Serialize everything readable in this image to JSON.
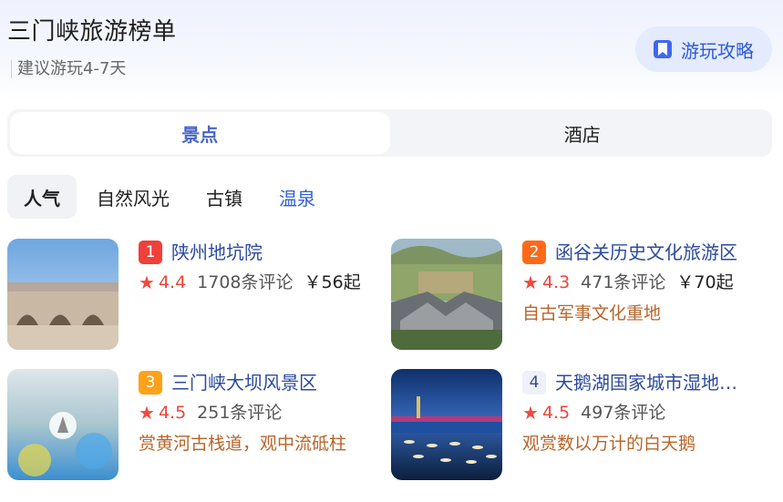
{
  "header": {
    "title": "三门峡旅游榜单",
    "subtitle": "建议游玩4-7天",
    "guide_button": "游玩攻略"
  },
  "tabs": [
    {
      "label": "景点",
      "active": true
    },
    {
      "label": "酒店",
      "active": false
    }
  ],
  "filters": [
    {
      "label": "人气",
      "active": true
    },
    {
      "label": "自然风光",
      "active": false
    },
    {
      "label": "古镇",
      "active": false
    },
    {
      "label": "温泉",
      "active": false
    }
  ],
  "items": [
    {
      "rank": "1",
      "rank_color": "#f0403a",
      "name": "陕州地坑院",
      "score": "4.4",
      "reviews": "1708条评论",
      "price": "￥56起",
      "tagline": ""
    },
    {
      "rank": "2",
      "rank_color": "#ff6a1a",
      "name": "函谷关历史文化旅游区",
      "score": "4.3",
      "reviews": "471条评论",
      "price": "￥70起",
      "tagline": "自古军事文化重地"
    },
    {
      "rank": "3",
      "rank_color": "#ffa21a",
      "name": "三门峡大坝风景区",
      "score": "4.5",
      "reviews": "251条评论",
      "price": "",
      "tagline": "赏黄河古栈道，观中流砥柱"
    },
    {
      "rank": "4",
      "rank_color": "#eef1f8",
      "name": "天鹅湖国家城市湿地…",
      "score": "4.5",
      "reviews": "497条评论",
      "price": "",
      "tagline": "观赏数以万计的白天鹅"
    }
  ]
}
